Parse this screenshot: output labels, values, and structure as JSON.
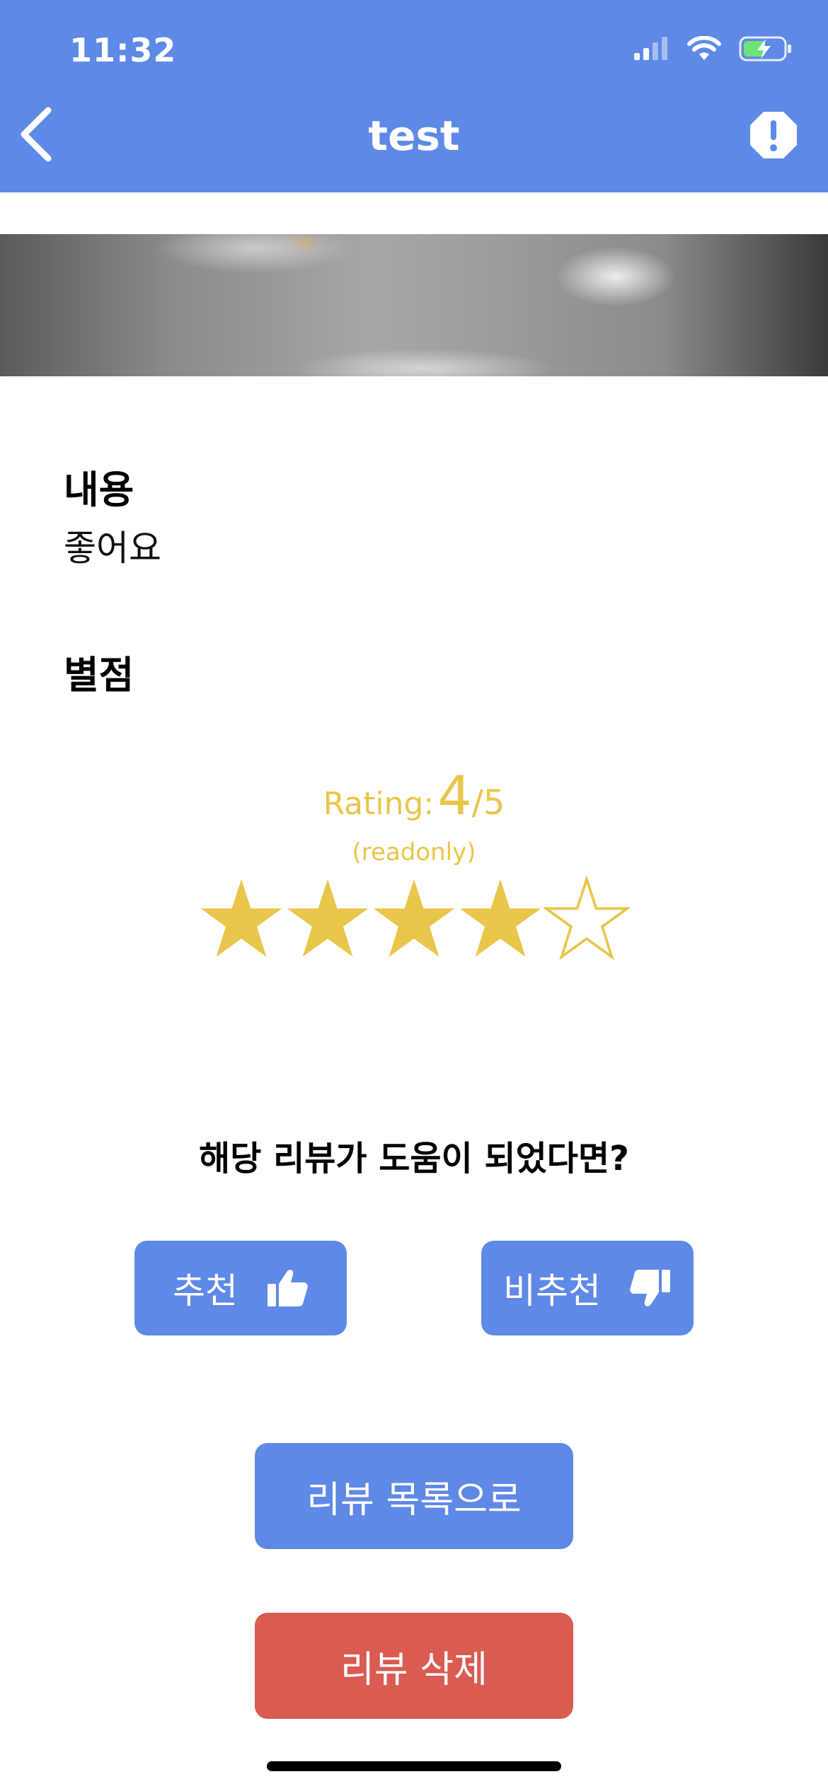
{
  "status_bar": {
    "time": "11:32"
  },
  "header": {
    "title": "test",
    "back_icon": "chevron-left-icon",
    "report_icon": "alert-octagon-icon",
    "color": "#5f89e6"
  },
  "content": {
    "label": "내용",
    "text": "좋어요"
  },
  "rating": {
    "label": "별점",
    "prefix": "Rating:",
    "value": "4",
    "denominator": "/5",
    "mode_text": "(readonly)",
    "stars_filled": 4,
    "stars_total": 5,
    "color": "#e9c54a"
  },
  "helpful": {
    "question": "해당 리뷰가 도움이 되었다면?",
    "recommend_label": "추천",
    "not_recommend_label": "비추천",
    "recommend_icon": "thumbs-up-icon",
    "not_recommend_icon": "thumbs-down-icon"
  },
  "actions": {
    "list_label": "리뷰 목록으로",
    "delete_label": "리뷰 삭제",
    "list_color": "#5f89e6",
    "delete_color": "#d95b51"
  }
}
